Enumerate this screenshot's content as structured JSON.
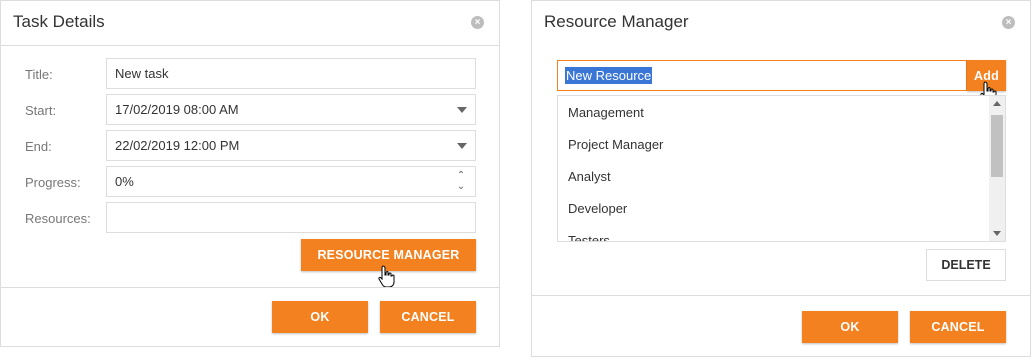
{
  "task_details": {
    "title": "Task Details",
    "labels": {
      "title": "Title:",
      "start": "Start:",
      "end": "End:",
      "progress": "Progress:",
      "resources": "Resources:"
    },
    "values": {
      "title": "New task",
      "start": "17/02/2019 08:00 AM",
      "end": "22/02/2019 12:00 PM",
      "progress": "0%",
      "resources": ""
    },
    "resource_manager_button": "RESOURCE MANAGER",
    "ok_button": "OK",
    "cancel_button": "CANCEL"
  },
  "resource_manager": {
    "title": "Resource Manager",
    "input_value": "New Resource",
    "add_button": "Add",
    "items": [
      "Management",
      "Project Manager",
      "Analyst",
      "Developer",
      "Testers"
    ],
    "delete_button": "DELETE",
    "ok_button": "OK",
    "cancel_button": "CANCEL"
  },
  "colors": {
    "accent": "#f48120",
    "selection": "#3a76d6",
    "border": "#dddddd",
    "label": "#777777"
  },
  "icons": [
    "close-icon",
    "dropdown-arrow-icon",
    "spinner-icon",
    "hand-cursor-icon"
  ]
}
